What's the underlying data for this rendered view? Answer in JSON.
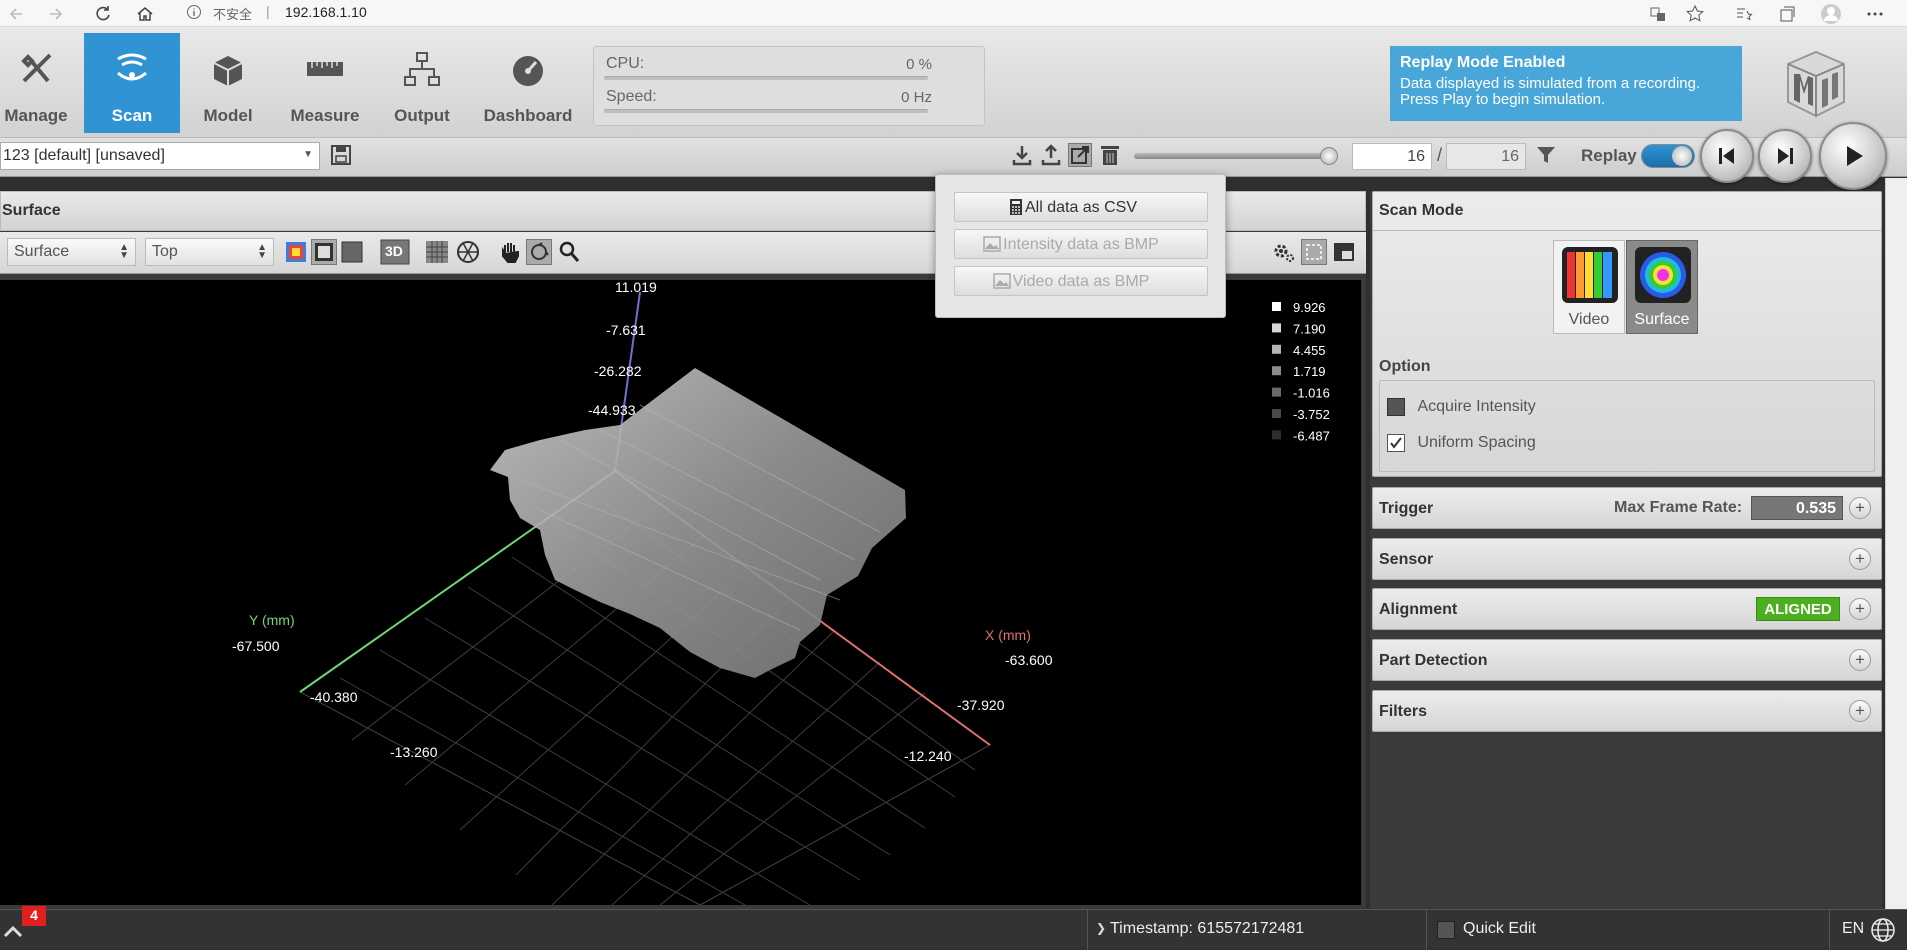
{
  "browser": {
    "security_label": "不安全",
    "separator": "|",
    "url": "192.168.1.10"
  },
  "nav": {
    "items": [
      {
        "label": "Manage",
        "icon": "tools-icon"
      },
      {
        "label": "Scan",
        "icon": "scan-icon"
      },
      {
        "label": "Model",
        "icon": "model-icon"
      },
      {
        "label": "Measure",
        "icon": "ruler-icon"
      },
      {
        "label": "Output",
        "icon": "network-icon"
      },
      {
        "label": "Dashboard",
        "icon": "gauge-icon"
      }
    ],
    "active": "Scan"
  },
  "metrics": {
    "cpu_label": "CPU:",
    "cpu_value": "0 %",
    "speed_label": "Speed:",
    "speed_value": "0 Hz"
  },
  "replay_notice": {
    "title": "Replay Mode Enabled",
    "line1": "Data displayed is simulated from a recording.",
    "line2": "Press Play to begin simulation."
  },
  "toolbar": {
    "job_name": "123 [default] [unsaved]",
    "frame_current": "16",
    "frame_separator": "/",
    "frame_total": "16",
    "replay_label": "Replay",
    "replay_enabled": true
  },
  "export_menu": {
    "items": [
      {
        "label": "All data as CSV",
        "enabled": true
      },
      {
        "label": "Intensity data as BMP",
        "enabled": false
      },
      {
        "label": "Video data as BMP",
        "enabled": false
      }
    ]
  },
  "surface_panel": {
    "title": "Surface",
    "view_type": "Surface",
    "view_angle": "Top",
    "btn_3d": "3D"
  },
  "plot": {
    "z_ticks": [
      "11.019",
      "-7.631",
      "-26.282",
      "-44.933"
    ],
    "y_axis_label": "Y (mm)",
    "y_ticks": [
      "-67.500",
      "-40.380",
      "-13.260"
    ],
    "x_axis_label": "X (mm)",
    "x_ticks": [
      "-63.600",
      "-37.920",
      "-12.240"
    ],
    "legend": [
      "9.926",
      "7.190",
      "4.455",
      "1.719",
      "-1.016",
      "-3.752",
      "-6.487"
    ],
    "legend_colors": [
      "#ffffff",
      "#d8d8d8",
      "#b3b3b3",
      "#8c8c8c",
      "#6a6a6a",
      "#4a4a4a",
      "#2e2e2e"
    ],
    "x_axis_color": "#e07070",
    "y_axis_color": "#6fd66f",
    "z_axis_color": "#7070d0"
  },
  "scan_mode": {
    "title": "Scan Mode",
    "modes": [
      {
        "label": "Video",
        "selected": false
      },
      {
        "label": "Surface",
        "selected": true
      }
    ],
    "option_title": "Option",
    "options": [
      {
        "label": "Acquire Intensity",
        "checked": false
      },
      {
        "label": "Uniform Spacing",
        "checked": true
      }
    ]
  },
  "sections": {
    "trigger": {
      "title": "Trigger",
      "field_label": "Max Frame Rate:",
      "field_value": "0.535"
    },
    "sensor": {
      "title": "Sensor"
    },
    "alignment": {
      "title": "Alignment",
      "badge": "ALIGNED",
      "badge_color": "#4caf1f"
    },
    "part_detection": {
      "title": "Part Detection"
    },
    "filters": {
      "title": "Filters"
    }
  },
  "statusbar": {
    "notification_count": "4",
    "timestamp": "Timestamp: 615572172481",
    "quick_edit": "Quick Edit",
    "language": "EN"
  }
}
